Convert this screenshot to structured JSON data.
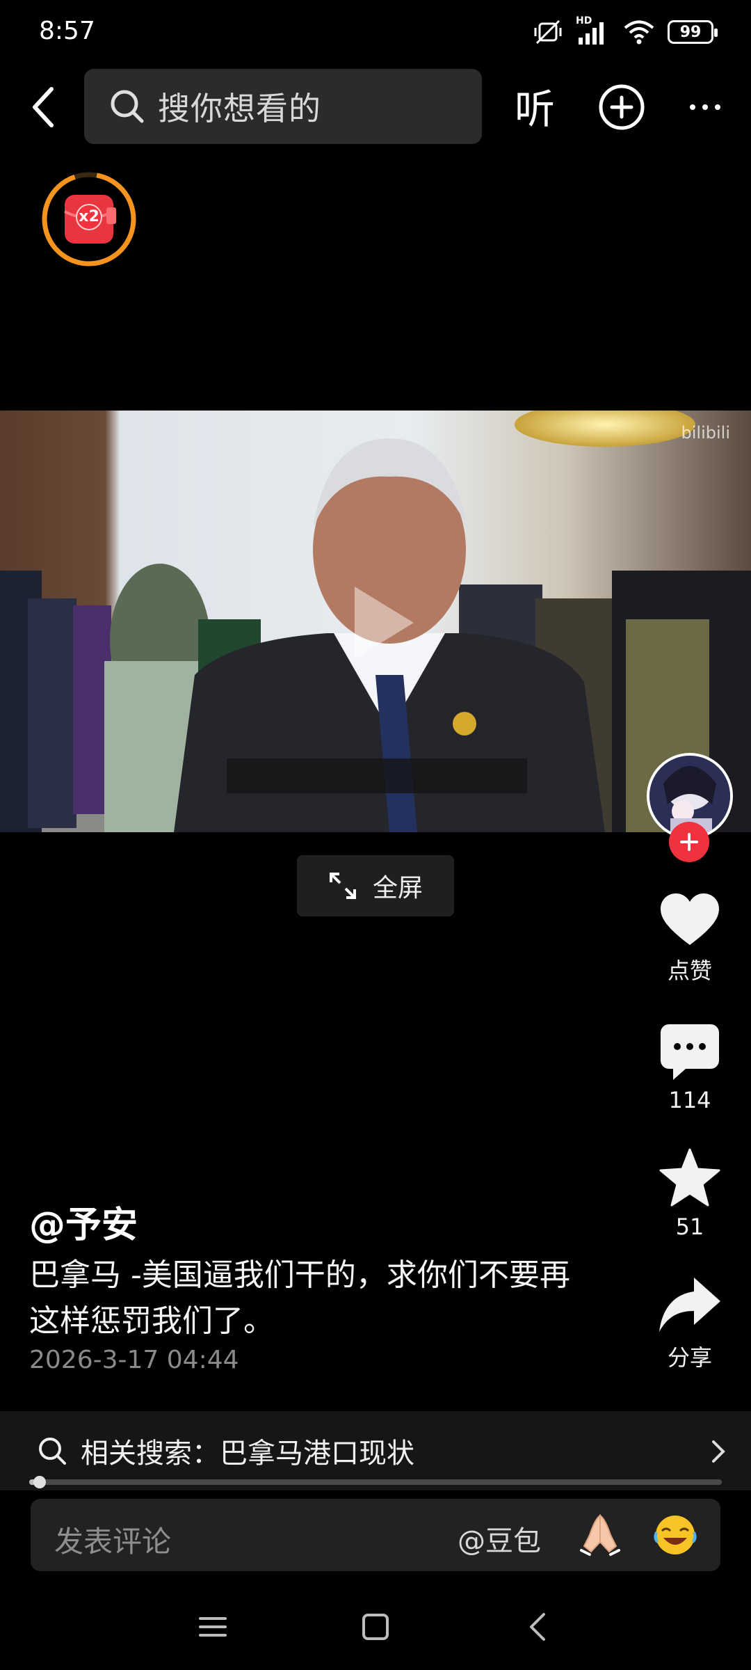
{
  "status_bar": {
    "time": "8:57",
    "network_label": "HD",
    "battery": "99"
  },
  "top_nav": {
    "search_placeholder": "搜你想看的",
    "listen_label": "听"
  },
  "red_packet": {
    "multiplier": "x2"
  },
  "video": {
    "fullscreen_label": "全屏"
  },
  "actions": {
    "like_label": "点赞",
    "comments_count": "114",
    "favorites_count": "51",
    "share_label": "分享"
  },
  "post": {
    "author": "@予安",
    "caption": "巴拿马 -美国逼我们干的，求你们不要再这样惩罚我们了。",
    "timestamp": "2026-3-17 04:44"
  },
  "related_search": {
    "text": "相关搜索：巴拿马港口现状"
  },
  "playback": {
    "progress_fraction": 0.01
  },
  "comment_bar": {
    "placeholder": "发表评论",
    "mention": "@豆包"
  },
  "colors": {
    "accent_red": "#f0323e",
    "ring_orange": "#f5931f"
  }
}
